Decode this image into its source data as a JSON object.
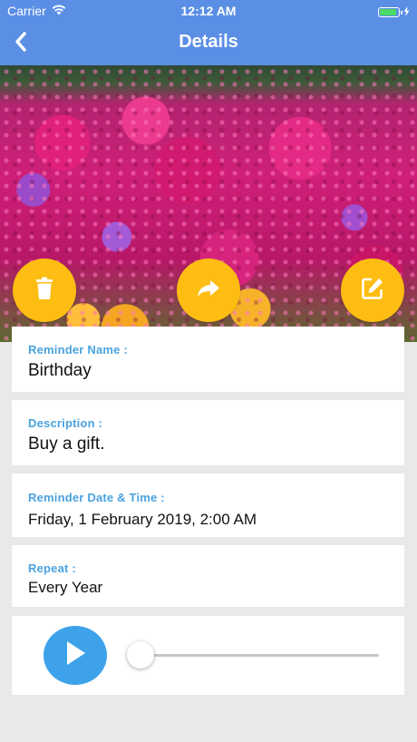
{
  "status_bar": {
    "carrier": "Carrier",
    "time": "12:12 AM",
    "battery_level": 1.0
  },
  "nav": {
    "title": "Details",
    "back_icon": "chevron-left-icon"
  },
  "hero": {
    "description_icon": "flowers-photo"
  },
  "actions": {
    "delete_icon": "trash-icon",
    "share_icon": "share-arrow-icon",
    "edit_icon": "edit-pencil-icon",
    "color": "#fdbd12"
  },
  "details": {
    "name_label": "Reminder Name :",
    "name_value": "Birthday",
    "description_label": "Description :",
    "description_value": "Buy a gift.",
    "datetime_label": "Reminder Date & Time :",
    "datetime_value": "Friday, 1 February 2019, 2:00 AM",
    "repeat_label": "Repeat :",
    "repeat_value": "Every Year"
  },
  "player": {
    "play_icon": "play-icon",
    "progress": 0.0
  },
  "colors": {
    "nav": "#5b8fe6",
    "label": "#4aa3df",
    "play": "#3ea2ea",
    "background": "#e9e9ea"
  }
}
